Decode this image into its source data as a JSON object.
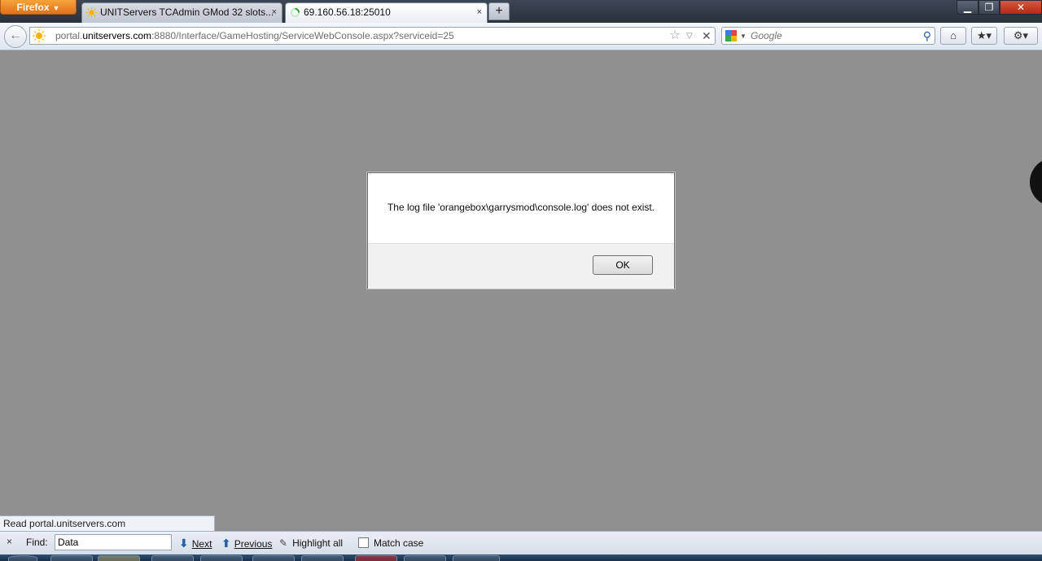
{
  "browser": {
    "menu_label": "Firefox",
    "tabs": [
      {
        "title": "UNITServers TCAdmin GMod 32 slots...",
        "close": "×"
      },
      {
        "title": "69.160.56.18:25010",
        "close": "×"
      }
    ],
    "new_tab": "+",
    "window_controls": {
      "minimize": "▁",
      "maximize": "❐",
      "close": "✕"
    }
  },
  "navigation": {
    "back": "←",
    "url": {
      "prefix": "portal.",
      "domain": "unitservers.com",
      "rest": ":8880/Interface/GameHosting/ServiceWebConsole.aspx?serviceid=25"
    },
    "search": {
      "placeholder": "Google",
      "engine_icon": "google-icon"
    },
    "icons": {
      "home": "⌂",
      "bookmarks": "★▾",
      "addon": "⚙▾",
      "star": "☆",
      "dropdown": "▽",
      "stop": "✕",
      "search_go": "⚲"
    }
  },
  "dialog": {
    "message": "The log file 'orangebox\\garrysmod\\console.log' does not exist.",
    "ok_label": "OK"
  },
  "status_bar": {
    "text": "Read portal.unitservers.com"
  },
  "find_bar": {
    "close": "×",
    "label": "Find:",
    "value": "Data",
    "next": "Next",
    "previous": "Previous",
    "highlight_all": "Highlight all",
    "match_case": "Match case"
  },
  "colors": {
    "accent_orange": "#e67e22",
    "page_background": "#909090"
  }
}
